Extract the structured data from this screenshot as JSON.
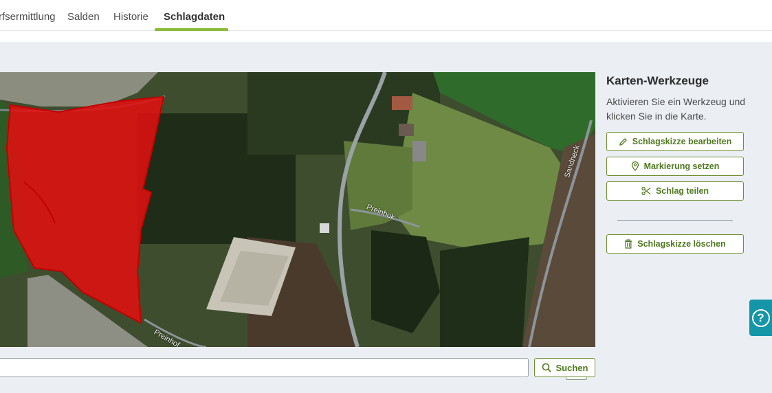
{
  "tabs": [
    {
      "label": "rfsermittlung"
    },
    {
      "label": "Salden"
    },
    {
      "label": "Historie"
    },
    {
      "label": "Schlagdaten",
      "active": true
    }
  ],
  "map": {
    "road_labels": [
      "Preinhok",
      "Sandheck",
      "Preinhof"
    ],
    "copyright_symbol": "©",
    "field_color": "#e01010"
  },
  "search": {
    "value": "",
    "placeholder": "",
    "button_label": "Suchen"
  },
  "tools": {
    "title": "Karten-Werkzeuge",
    "description": "Aktivieren Sie ein Werkzeug und klicken Sie in die Karte.",
    "buttons": [
      {
        "label": "Schlagskizze bearbeiten",
        "icon": "pencil-icon"
      },
      {
        "label": "Markierung setzen",
        "icon": "map-pin-icon"
      },
      {
        "label": "Schlag teilen",
        "icon": "scissors-icon"
      }
    ],
    "delete_button": {
      "label": "Schlagskizze löschen",
      "icon": "trash-icon"
    }
  },
  "help": {
    "symbol": "?"
  },
  "colors": {
    "accent": "#8cbb3c",
    "button_text": "#4f7a1f",
    "help": "#1496a8"
  }
}
